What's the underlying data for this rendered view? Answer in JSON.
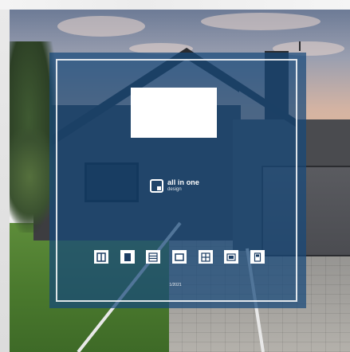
{
  "brand": {
    "name": "all in one",
    "tagline": "design",
    "logo_icon": "logo-mark-icon"
  },
  "edition": "1/2021",
  "product_icons": [
    {
      "name": "door-two-panel-icon"
    },
    {
      "name": "door-dark-panel-icon"
    },
    {
      "name": "door-horizontal-lines-icon"
    },
    {
      "name": "door-plain-frame-icon"
    },
    {
      "name": "door-double-panel-icon"
    },
    {
      "name": "door-wide-panel-icon"
    },
    {
      "name": "door-window-icon"
    }
  ],
  "colors": {
    "overlay": "#16487a",
    "frame": "#ffffff"
  }
}
